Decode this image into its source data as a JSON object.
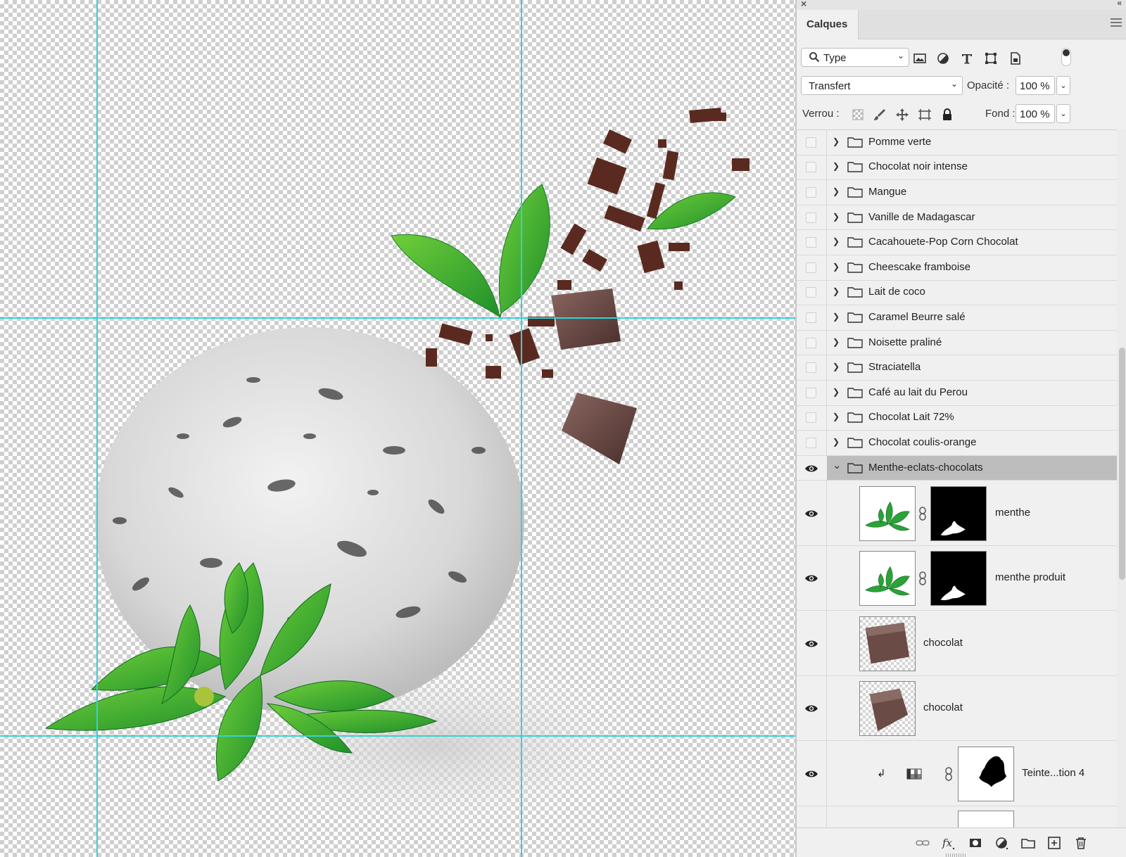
{
  "panel": {
    "close_glyph": "×",
    "collapse_glyph": "«",
    "tab_label": "Calques",
    "filter": {
      "kind_label": "Type",
      "icons": [
        "image-filter-icon",
        "adjustment-filter-icon",
        "type-filter-icon",
        "shape-filter-icon",
        "smart-object-filter-icon"
      ]
    },
    "blend_mode": "Transfert",
    "opacity_label": "Opacité :",
    "opacity_value": "100 %",
    "lock_label": "Verrou :",
    "fill_label": "Fond :",
    "fill_value": "100 %"
  },
  "layers": {
    "groups": [
      "Pomme verte",
      "Chocolat noir intense",
      "Mangue",
      "Vanille de Madagascar",
      "Cacahouete-Pop Corn Chocolat",
      "Cheescake framboise",
      "Lait de coco",
      "Caramel Beurre salé",
      "Noisette praliné",
      "Straciatella",
      "Café au lait du Perou",
      "Chocolat Lait 72%",
      "Chocolat coulis-orange"
    ],
    "open_group": "Menthe-eclats-chocolats",
    "children": [
      {
        "name": "menthe"
      },
      {
        "name": "menthe produit"
      },
      {
        "name": "chocolat"
      },
      {
        "name": "chocolat"
      },
      {
        "name": "Teinte...tion 4"
      }
    ]
  },
  "colors": {
    "guide": "#35d0d8",
    "selected_row": "#bdbdbd",
    "panel_bg": "#f0f0f0"
  }
}
